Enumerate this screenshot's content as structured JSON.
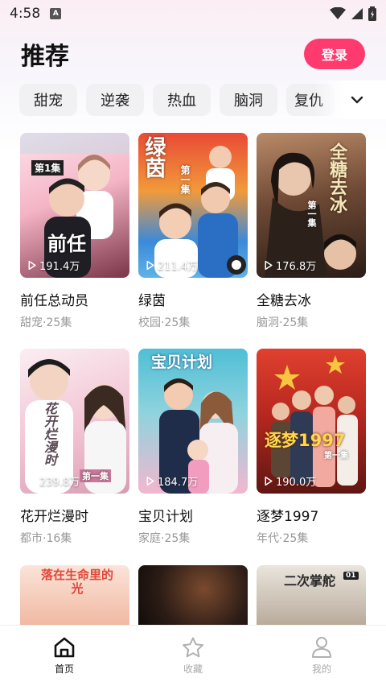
{
  "status": {
    "time": "4:58",
    "app_badge": "A"
  },
  "header": {
    "title": "推荐",
    "login_label": "登录"
  },
  "tabs": [
    {
      "label": "甜宠"
    },
    {
      "label": "逆袭"
    },
    {
      "label": "热血"
    },
    {
      "label": "脑洞"
    },
    {
      "label": "复仇"
    }
  ],
  "cards": [
    {
      "title": "前任总动员",
      "meta": "甜宠·25集",
      "views": "191.4万",
      "poster_text": "前任",
      "badge": "第1集",
      "colors": [
        "#f7c7d6",
        "#6d2a3a"
      ]
    },
    {
      "title": "绿茵",
      "meta": "校园·25集",
      "views": "211.4万",
      "poster_text": "绿茵",
      "badge": "第一集",
      "colors": [
        "#e64a3a",
        "#2f7fd8"
      ]
    },
    {
      "title": "全糖去冰",
      "meta": "脑洞·25集",
      "views": "176.8万",
      "poster_text": "全糖去冰",
      "badge": "第一集",
      "colors": [
        "#8a5a3e",
        "#2b1a14"
      ]
    },
    {
      "title": "花开烂漫时",
      "meta": "都市·16集",
      "views": "239.8万",
      "poster_text": "花开烂漫时",
      "badge": "第一集",
      "colors": [
        "#f5dfe6",
        "#b78a9e"
      ]
    },
    {
      "title": "宝贝计划",
      "meta": "家庭·25集",
      "views": "184.7万",
      "poster_text": "宝贝计划",
      "badge": "",
      "colors": [
        "#6cc7d9",
        "#d98bb0"
      ]
    },
    {
      "title": "逐梦1997",
      "meta": "年代·25集",
      "views": "190.0万",
      "poster_text": "逐梦1997",
      "badge": "第一集",
      "colors": [
        "#d9372c",
        "#5a1712"
      ]
    },
    {
      "title": "",
      "meta": "",
      "views": "",
      "poster_text": "落在生命里的光",
      "badge": "",
      "colors": [
        "#f3d6c8",
        "#e7a690"
      ]
    },
    {
      "title": "",
      "meta": "",
      "views": "",
      "poster_text": "",
      "badge": "",
      "colors": [
        "#3a2a24",
        "#1b1411"
      ]
    },
    {
      "title": "",
      "meta": "",
      "views": "",
      "poster_text": "二次掌舵",
      "badge": "01",
      "colors": [
        "#dcd6cc",
        "#9b8a7a"
      ]
    }
  ],
  "bottom_nav": [
    {
      "label": "首页",
      "icon": "home-icon"
    },
    {
      "label": "收藏",
      "icon": "star-icon"
    },
    {
      "label": "我的",
      "icon": "user-icon"
    }
  ],
  "accent": "#ff3a6e"
}
